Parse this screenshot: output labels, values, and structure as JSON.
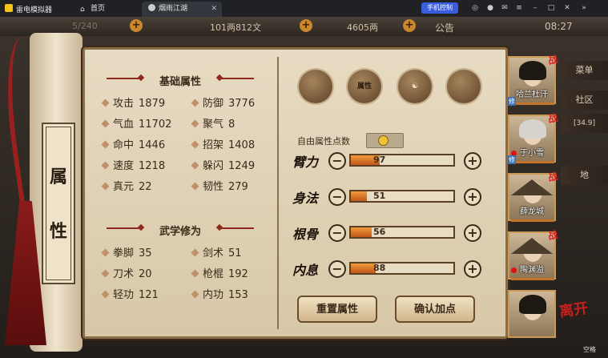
{
  "emulator": {
    "app_name": "雷电模拟器",
    "tabs": [
      {
        "label": "首页"
      },
      {
        "label": "烟雨江湖"
      }
    ],
    "phone_control": "手机控制"
  },
  "game_topbar": {
    "stamina": "5/240",
    "currency1": "101两812文",
    "currency2": "4605两",
    "notice": "公告",
    "clock": "08:27"
  },
  "scroll_title": [
    "属",
    "性"
  ],
  "basic_attributes": {
    "title": "基础属性",
    "stats": [
      {
        "label": "攻击",
        "value": "1879"
      },
      {
        "label": "防御",
        "value": "3776"
      },
      {
        "label": "气血",
        "value": "11702"
      },
      {
        "label": "聚气",
        "value": "8"
      },
      {
        "label": "命中",
        "value": "1446"
      },
      {
        "label": "招架",
        "value": "1408"
      },
      {
        "label": "速度",
        "value": "1218"
      },
      {
        "label": "躲闪",
        "value": "1249"
      },
      {
        "label": "真元",
        "value": "22"
      },
      {
        "label": "韧性",
        "value": "279"
      }
    ]
  },
  "martial_arts": {
    "title": "武学修为",
    "stats": [
      {
        "label": "拳脚",
        "value": "35"
      },
      {
        "label": "剑术",
        "value": "51"
      },
      {
        "label": "刀术",
        "value": "20"
      },
      {
        "label": "枪棍",
        "value": "192"
      },
      {
        "label": "轻功",
        "value": "121"
      },
      {
        "label": "内功",
        "value": "153"
      }
    ]
  },
  "category_tab_label": "属性",
  "free_points": {
    "label": "自由属性点数",
    "value": "0"
  },
  "allocations": [
    {
      "label": "臂力",
      "value": "97",
      "fraction": 0.28
    },
    {
      "label": "身法",
      "value": "51",
      "fraction": 0.16
    },
    {
      "label": "根骨",
      "value": "56",
      "fraction": 0.2
    },
    {
      "label": "内息",
      "value": "88",
      "fraction": 0.24
    }
  ],
  "buttons": {
    "reset": "重置属性",
    "confirm": "确认加点"
  },
  "roster": [
    {
      "name": "哈兰杜汗",
      "status": "战",
      "tag": "修"
    },
    {
      "name": "于小雪",
      "status": "战",
      "tag": "修"
    },
    {
      "name": "薛龙城",
      "status": "战",
      "tag": ""
    },
    {
      "name": "陶渊溢",
      "status": "战",
      "tag": ""
    },
    {
      "name": "",
      "status": "",
      "tag": ""
    }
  ],
  "side_menu": [
    "菜单",
    "社区",
    "[34.9]",
    "地"
  ],
  "leave_label": "离开",
  "space_hint": "空格",
  "colors": {
    "accent_red": "#8e2a1d",
    "bar_fill": "#e0762a",
    "paper": "#e7dbc3"
  }
}
